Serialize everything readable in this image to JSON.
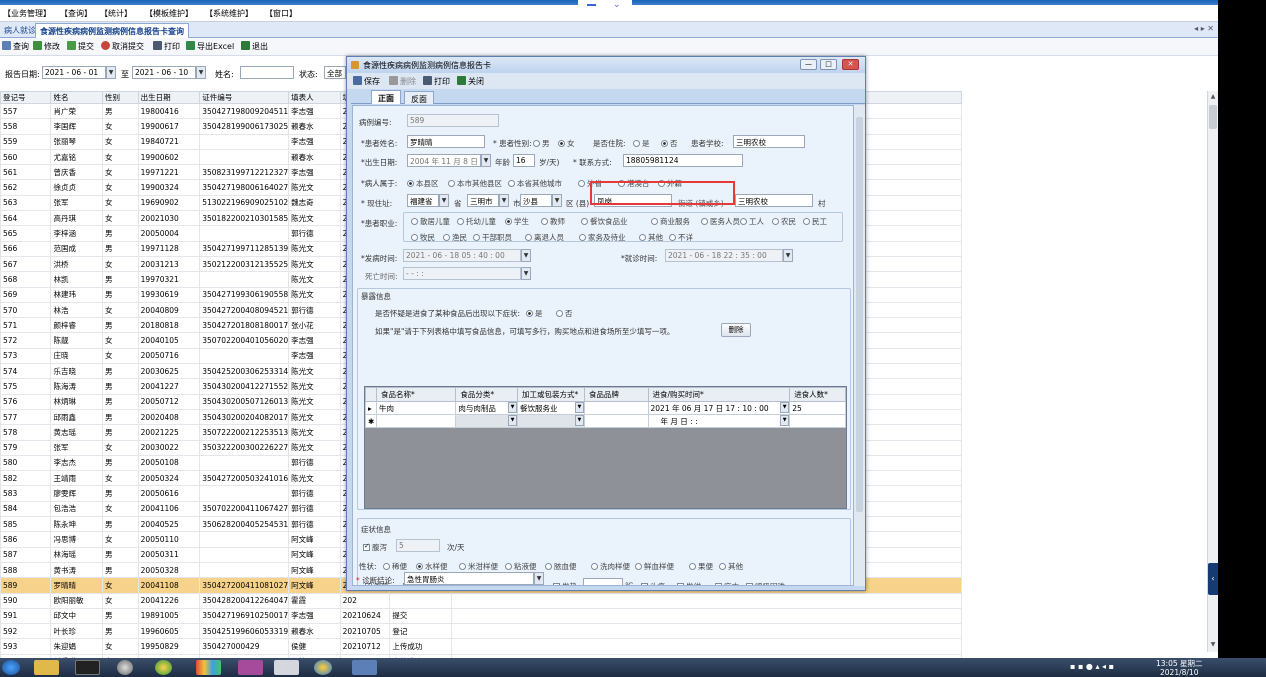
{
  "menu": [
    "【业务管理】",
    "【查询】",
    "【统计】",
    "【模板维护】",
    "【系统维护】",
    "【窗口】"
  ],
  "tabs": [
    "病人就诊",
    "食源性疾病病例监测病例信息报告卡查询"
  ],
  "tabs_ctrl": "◂ ▸ ✕",
  "toolbar": [
    "查询",
    "修改",
    "提交",
    "取消提交",
    "打印",
    "导出Excel",
    "退出"
  ],
  "search": {
    "date_label": "报告日期:",
    "date_from": "2021 - 06 - 01",
    "to": "至",
    "date_to": "2021 - 06 - 10",
    "name_label": "姓名:",
    "name_value": "",
    "status_label": "状态:",
    "status_value": "全部"
  },
  "grid": {
    "headers": [
      "登记号",
      "姓名",
      "性别",
      "出生日期",
      "证件编号",
      "填表人",
      "填"
    ],
    "rows": [
      [
        "557",
        "肖广荣",
        "男",
        "19800416",
        "350427198009204511",
        "李志强",
        "202"
      ],
      [
        "558",
        "李国辉",
        "女",
        "19900617",
        "350428199006173025",
        "赖春水",
        "202"
      ],
      [
        "559",
        "张丽琴",
        "女",
        "19840721",
        "",
        "李志强",
        "202"
      ],
      [
        "560",
        "尤嘉铭",
        "女",
        "19900602",
        "",
        "赖春水",
        "202"
      ],
      [
        "561",
        "曾庆香",
        "女",
        "19971221",
        "350823199712212327",
        "李志强",
        "202"
      ],
      [
        "562",
        "徐贞贞",
        "女",
        "19900324",
        "350427198006164027",
        "陈光文",
        "202"
      ],
      [
        "563",
        "张军",
        "女",
        "19690902",
        "513022196909025102",
        "魏志奇",
        "202"
      ],
      [
        "564",
        "高丹琪",
        "女",
        "20021030",
        "350182200210301585",
        "陈光文",
        "202"
      ],
      [
        "565",
        "李梓涵",
        "男",
        "20050004",
        "",
        "郭行德",
        "202"
      ],
      [
        "566",
        "范国成",
        "男",
        "19971128",
        "350427199711285139",
        "陈光文",
        "202"
      ],
      [
        "567",
        "洪桥",
        "女",
        "20031213",
        "350212200312135525",
        "陈光文",
        "202"
      ],
      [
        "568",
        "林凯",
        "男",
        "19970321",
        "",
        "陈光文",
        "202"
      ],
      [
        "569",
        "林建玮",
        "男",
        "19930619",
        "350427199306190558",
        "陈光文",
        "202"
      ],
      [
        "570",
        "林浩",
        "女",
        "20040809",
        "350427200408094521",
        "郭行德",
        "202"
      ],
      [
        "571",
        "颜梓睿",
        "男",
        "20180818",
        "350427201808180017",
        "张小花",
        "202"
      ],
      [
        "572",
        "陈靓",
        "女",
        "20040105",
        "350702200401056020",
        "李志强",
        "202"
      ],
      [
        "573",
        "庄晓",
        "女",
        "20050716",
        "",
        "李志强",
        "202"
      ],
      [
        "574",
        "乐吉晓",
        "男",
        "20030625",
        "350425200306253314",
        "陈光文",
        "202"
      ],
      [
        "575",
        "陈海涛",
        "男",
        "20041227",
        "350430200412271552",
        "陈光文",
        "202"
      ],
      [
        "576",
        "林炳琳",
        "男",
        "20050712",
        "350430200507126013",
        "陈光文",
        "202"
      ],
      [
        "577",
        "邱雨鑫",
        "男",
        "20020408",
        "350430200204082017",
        "陈光文",
        "202"
      ],
      [
        "578",
        "黄志瑶",
        "男",
        "20021225",
        "350722200212253513",
        "陈光文",
        "202"
      ],
      [
        "579",
        "张军",
        "女",
        "20030022",
        "350322200300226227",
        "陈光文",
        "202"
      ],
      [
        "580",
        "李志杰",
        "男",
        "20050108",
        "",
        "郭行德",
        "202"
      ],
      [
        "582",
        "王靖雨",
        "女",
        "20050324",
        "350427200503241016",
        "陈光文",
        "202"
      ],
      [
        "583",
        "廖雯辉",
        "男",
        "20050616",
        "",
        "郭行德",
        "202"
      ],
      [
        "584",
        "包浩浩",
        "女",
        "20041106",
        "350702200411067427",
        "郭行德",
        "202"
      ],
      [
        "585",
        "陈永坤",
        "男",
        "20040525",
        "350628200405254531",
        "郭行德",
        "202"
      ],
      [
        "586",
        "冯思博",
        "女",
        "20050110",
        "",
        "阿文峰",
        "202"
      ],
      [
        "587",
        "林海瑶",
        "男",
        "20050311",
        "",
        "阿文峰",
        "202"
      ],
      [
        "588",
        "黄书涛",
        "男",
        "20050328",
        "",
        "阿文峰",
        "202"
      ],
      [
        "589",
        "罗晴晴",
        "女",
        "20041108",
        "350427200411081027",
        "阿文峰",
        "202"
      ],
      [
        "590",
        "欧阳丽敏",
        "女",
        "20041226",
        "350428200412264047",
        "霍霞",
        "202"
      ],
      [
        "591",
        "邱文中",
        "男",
        "19891005",
        "350427196910250017",
        "李志强",
        "20210624",
        "提交"
      ],
      [
        "592",
        "叶长珍",
        "男",
        "19960605",
        "350425199606053319",
        "赖春水",
        "20210705",
        "登记"
      ],
      [
        "593",
        "朱迎娟",
        "女",
        "19950829",
        "350427000429",
        "侯健",
        "20210712",
        "上传成功"
      ],
      [
        "594",
        "付秀琪",
        "女",
        "19721221",
        "350523197212213205",
        "侯健",
        "20210713",
        "上传成功"
      ]
    ],
    "selected_index": 31
  },
  "modal": {
    "title": "食源性疾病病例监测病例信息报告卡",
    "tools": [
      "保存",
      "删除",
      "打印",
      "关闭"
    ],
    "tabs": [
      "正面",
      "反面"
    ],
    "card_no_label": "病例编号:",
    "card_no": "589",
    "name_label": "*患者姓名:",
    "name_value": "罗晴晴",
    "gender_label": "* 患者性别:",
    "gender_male": "男",
    "gender_female": "女",
    "inschool_label": "是否住院:",
    "yes": "是",
    "no": "否",
    "school_label": "患者学校:",
    "school_value": "三明农校",
    "birth_label": "*出生日期:",
    "birth_value": "2004 年 11 月 8 日",
    "age_label": "年龄",
    "age_value": "16",
    "age_unit": "岁/天)",
    "phone_label": "* 联系方式:",
    "phone_value": "18805981124",
    "belong_label": "*病人属于:",
    "belong_opts": [
      "本县区",
      "本市其他县区",
      "本省其他城市",
      "外省",
      "港澳台",
      "外籍"
    ],
    "addr_label": "* 现住址:",
    "addr_prov": "福建省",
    "addr_prov_unit": "省",
    "addr_city": "三明市",
    "addr_city_unit": "市",
    "addr_county": "沙县",
    "addr_county_unit": "区 (县)",
    "addr_town": "凤岗",
    "addr_town_hint": "街道 (镇或乡)",
    "addr_village": "三明农校",
    "addr_village_unit": "村",
    "job_label": "*患者职业:",
    "jobs_row1": [
      "散居儿童",
      "托幼儿童",
      "学生",
      "教师",
      "餐饮食品业",
      "商业服务",
      "医务人员",
      "工人",
      "农民",
      "民工"
    ],
    "jobs_row2": [
      "牧民",
      "渔民",
      "干部职员",
      "离退人员",
      "家务及待业",
      "其他",
      "不详"
    ],
    "onset_label": "*发病时间:",
    "onset_value": "2021 - 06 - 18   05 : 40 : 00",
    "visit_label": "*就诊时间:",
    "visit_value": "2021 - 06 - 18   22 : 35 : 00",
    "death_label": "死亡时间:",
    "death_value": "-   -     :   :",
    "expo_title": "暴露信息",
    "expo_q": "是否怀疑是进食了某种食品后出现以下症状:",
    "expo_hint": "如果\"是\"请于下列表格中填写食品信息，可填写多行，购买地点和进食场所至少填写一项。",
    "delete_btn": "删除",
    "food_headers": [
      "食品名称*",
      "食品分类*",
      "加工或包装方式*",
      "食品品牌",
      "进食/购买时间*",
      "进食人数*"
    ],
    "food_row": {
      "name": "牛肉",
      "category": "肉与肉制品",
      "process": "餐饮服务业",
      "brand": "",
      "time": "2021 年 06 月 17 日  17 : 10 : 00",
      "count": "25"
    },
    "food_new_time": "年   月   日     :    :",
    "symptom_title": "症状信息",
    "diarrhea_label": "腹泻",
    "diarrhea_value": "5",
    "diarrhea_unit": "次/天",
    "stool_label": "性状:",
    "stool_opts": [
      "稀便",
      "水样便",
      "米泔样便",
      "粘液便",
      "脓血便",
      "洗肉样便",
      "鲜血样便",
      "果便",
      "其他"
    ],
    "sym_row1": [
      "腹痛",
      "恶心",
      "呕吐:",
      "次/天",
      "发热:",
      "℃",
      "头痛",
      "发绀",
      "麻木",
      "呼吸困难"
    ],
    "sym_row2": [
      "咽喉困难",
      "面色潮红",
      "视物模糊",
      "眼睑下垂",
      "抽搐",
      "昏迷",
      "其他:"
    ],
    "diag_label": "诊断结论:",
    "diag_value": "急性胃肠炎"
  },
  "clock": {
    "time": "13:05 星期二",
    "date": "2021/8/10"
  },
  "colors": {
    "selected_row": "#f7d28a",
    "highlight_box": "#e43a3a",
    "accent": "#1c63b8"
  }
}
